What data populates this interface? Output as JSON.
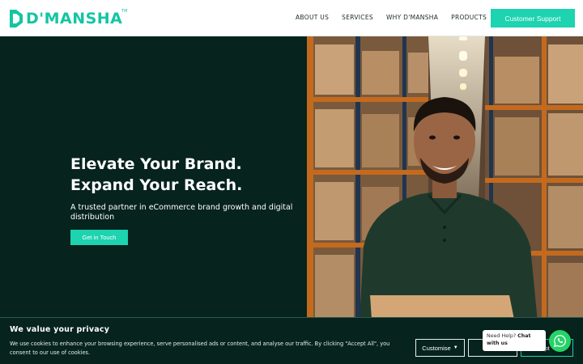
{
  "header": {
    "logo_text": "D'MANSHA",
    "logo_tm": "TM",
    "nav": [
      {
        "label": "ABOUT US"
      },
      {
        "label": "SERVICES"
      },
      {
        "label": "WHY D'MANSHA"
      },
      {
        "label": "PRODUCTS"
      }
    ],
    "support_label": "Customer Support"
  },
  "hero": {
    "title_line1": "Elevate Your Brand.",
    "title_line2": "Expand Your Reach.",
    "subtitle": "A trusted partner in eCommerce brand growth and digital distribution",
    "cta_label": "Get in Touch"
  },
  "cookie": {
    "title": "We value your privacy",
    "text": "We use cookies to enhance your browsing experience, serve personalised ads or content, and analyse our traffic. By clicking \"Accept All\", you consent to our use of cookies.",
    "customise_label": "Customise",
    "reject_label": "Re",
    "accept_label": "pt"
  },
  "chat": {
    "prompt": "Need Help?",
    "action": "Chat with us"
  },
  "colors": {
    "accent": "#1dd3b0",
    "hero_bg": "#06231d",
    "whatsapp": "#25d366"
  },
  "icons": {
    "logo": "dmansha-logo-mark",
    "whatsapp": "whatsapp-icon",
    "caret": "caret-down-icon"
  }
}
